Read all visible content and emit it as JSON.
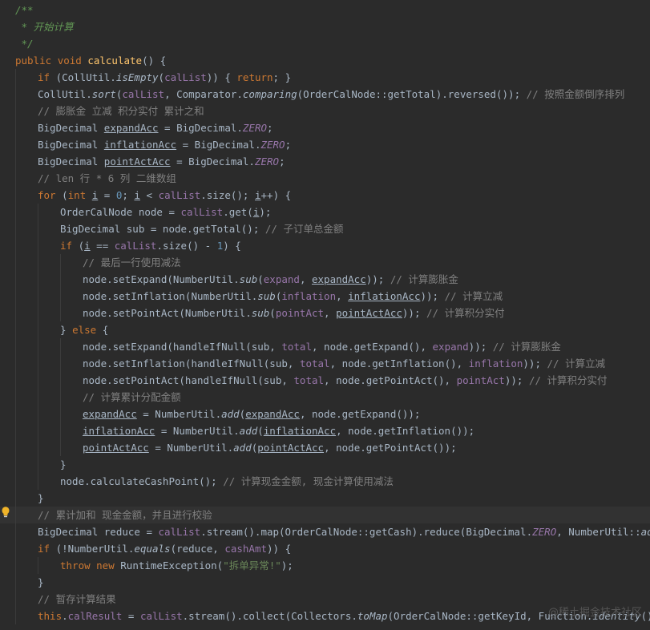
{
  "editor": {
    "lines": [
      {
        "indent": 0,
        "tokens": [
          {
            "t": "/**",
            "c": "dc"
          }
        ]
      },
      {
        "indent": 0,
        "tokens": [
          {
            "t": " * 开始计算",
            "c": "dc"
          }
        ]
      },
      {
        "indent": 0,
        "tokens": [
          {
            "t": " */",
            "c": "dc"
          }
        ]
      },
      {
        "indent": 0,
        "tokens": [
          {
            "t": "public ",
            "c": "kw"
          },
          {
            "t": "void ",
            "c": "kw"
          },
          {
            "t": "calculate",
            "c": "fn"
          },
          {
            "t": "() {"
          }
        ]
      },
      {
        "indent": 1,
        "tokens": [
          {
            "t": "if ",
            "c": "kw"
          },
          {
            "t": "(CollUtil."
          },
          {
            "t": "isEmpty",
            "c": "it"
          },
          {
            "t": "("
          },
          {
            "t": "calList",
            "c": "fld"
          },
          {
            "t": ")) { "
          },
          {
            "t": "return",
            "c": "kw"
          },
          {
            "t": "; }"
          }
        ]
      },
      {
        "indent": 1,
        "tokens": [
          {
            "t": "CollUtil."
          },
          {
            "t": "sort",
            "c": "it"
          },
          {
            "t": "("
          },
          {
            "t": "calList",
            "c": "fld"
          },
          {
            "t": ", Comparator."
          },
          {
            "t": "comparing",
            "c": "it"
          },
          {
            "t": "(OrderCalNode::getTotal).reversed()); "
          },
          {
            "t": "// 按照金额倒序排列",
            "c": "cm"
          }
        ]
      },
      {
        "indent": 1,
        "tokens": [
          {
            "t": "// 膨胀金 立减 积分实付 累计之和",
            "c": "cm"
          }
        ]
      },
      {
        "indent": 1,
        "tokens": [
          {
            "t": "BigDecimal "
          },
          {
            "t": "expandAcc",
            "c": "ul"
          },
          {
            "t": " = BigDecimal."
          },
          {
            "t": "ZERO",
            "c": "fld it"
          },
          {
            "t": ";"
          }
        ]
      },
      {
        "indent": 1,
        "tokens": [
          {
            "t": "BigDecimal "
          },
          {
            "t": "inflationAcc",
            "c": "ul"
          },
          {
            "t": " = BigDecimal."
          },
          {
            "t": "ZERO",
            "c": "fld it"
          },
          {
            "t": ";"
          }
        ]
      },
      {
        "indent": 1,
        "tokens": [
          {
            "t": "BigDecimal "
          },
          {
            "t": "pointActAcc",
            "c": "ul"
          },
          {
            "t": " = BigDecimal."
          },
          {
            "t": "ZERO",
            "c": "fld it"
          },
          {
            "t": ";"
          }
        ]
      },
      {
        "indent": 1,
        "tokens": [
          {
            "t": "// len 行 * 6 列 二维数组",
            "c": "cm"
          }
        ]
      },
      {
        "indent": 1,
        "tokens": [
          {
            "t": "for ",
            "c": "kw"
          },
          {
            "t": "("
          },
          {
            "t": "int ",
            "c": "kw"
          },
          {
            "t": "i",
            "c": "ul"
          },
          {
            "t": " = "
          },
          {
            "t": "0",
            "c": "nu"
          },
          {
            "t": "; "
          },
          {
            "t": "i",
            "c": "ul"
          },
          {
            "t": " < "
          },
          {
            "t": "calList",
            "c": "fld"
          },
          {
            "t": ".size(); "
          },
          {
            "t": "i",
            "c": "ul"
          },
          {
            "t": "++) {"
          }
        ]
      },
      {
        "indent": 2,
        "tokens": [
          {
            "t": "OrderCalNode node = "
          },
          {
            "t": "calList",
            "c": "fld"
          },
          {
            "t": ".get("
          },
          {
            "t": "i",
            "c": "ul"
          },
          {
            "t": ");"
          }
        ]
      },
      {
        "indent": 2,
        "tokens": [
          {
            "t": "BigDecimal sub = node.getTotal(); "
          },
          {
            "t": "// 子订单总金额",
            "c": "cm"
          }
        ]
      },
      {
        "indent": 2,
        "tokens": [
          {
            "t": "if ",
            "c": "kw"
          },
          {
            "t": "("
          },
          {
            "t": "i",
            "c": "ul"
          },
          {
            "t": " == "
          },
          {
            "t": "calList",
            "c": "fld"
          },
          {
            "t": ".size() - "
          },
          {
            "t": "1",
            "c": "nu"
          },
          {
            "t": ") {"
          }
        ]
      },
      {
        "indent": 3,
        "tokens": [
          {
            "t": "// 最后一行使用减法",
            "c": "cm"
          }
        ]
      },
      {
        "indent": 3,
        "tokens": [
          {
            "t": "node.setExpand(NumberUtil."
          },
          {
            "t": "sub",
            "c": "it"
          },
          {
            "t": "("
          },
          {
            "t": "expand",
            "c": "fld"
          },
          {
            "t": ", "
          },
          {
            "t": "expandAcc",
            "c": "ul"
          },
          {
            "t": ")); "
          },
          {
            "t": "// 计算膨胀金",
            "c": "cm"
          }
        ]
      },
      {
        "indent": 3,
        "tokens": [
          {
            "t": "node.setInflation(NumberUtil."
          },
          {
            "t": "sub",
            "c": "it"
          },
          {
            "t": "("
          },
          {
            "t": "inflation",
            "c": "fld"
          },
          {
            "t": ", "
          },
          {
            "t": "inflationAcc",
            "c": "ul"
          },
          {
            "t": ")); "
          },
          {
            "t": "// 计算立减",
            "c": "cm"
          }
        ]
      },
      {
        "indent": 3,
        "tokens": [
          {
            "t": "node.setPointAct(NumberUtil."
          },
          {
            "t": "sub",
            "c": "it"
          },
          {
            "t": "("
          },
          {
            "t": "pointAct",
            "c": "fld"
          },
          {
            "t": ", "
          },
          {
            "t": "pointActAcc",
            "c": "ul"
          },
          {
            "t": ")); "
          },
          {
            "t": "// 计算积分实付",
            "c": "cm"
          }
        ]
      },
      {
        "indent": 2,
        "tokens": [
          {
            "t": "} "
          },
          {
            "t": "else ",
            "c": "kw"
          },
          {
            "t": "{"
          }
        ]
      },
      {
        "indent": 3,
        "tokens": [
          {
            "t": "node.setExpand(handleIfNull(sub, "
          },
          {
            "t": "total",
            "c": "fld"
          },
          {
            "t": ", node.getExpand(), "
          },
          {
            "t": "expand",
            "c": "fld"
          },
          {
            "t": ")); "
          },
          {
            "t": "// 计算膨胀金",
            "c": "cm"
          }
        ]
      },
      {
        "indent": 3,
        "tokens": [
          {
            "t": "node.setInflation(handleIfNull(sub, "
          },
          {
            "t": "total",
            "c": "fld"
          },
          {
            "t": ", node.getInflation(), "
          },
          {
            "t": "inflation",
            "c": "fld"
          },
          {
            "t": ")); "
          },
          {
            "t": "// 计算立减",
            "c": "cm"
          }
        ]
      },
      {
        "indent": 3,
        "tokens": [
          {
            "t": "node.setPointAct(handleIfNull(sub, "
          },
          {
            "t": "total",
            "c": "fld"
          },
          {
            "t": ", node.getPointAct(), "
          },
          {
            "t": "pointAct",
            "c": "fld"
          },
          {
            "t": ")); "
          },
          {
            "t": "// 计算积分实付",
            "c": "cm"
          }
        ]
      },
      {
        "indent": 3,
        "tokens": [
          {
            "t": "// 计算累计分配金额",
            "c": "cm"
          }
        ]
      },
      {
        "indent": 3,
        "tokens": [
          {
            "t": "expandAcc",
            "c": "ul"
          },
          {
            "t": " = NumberUtil."
          },
          {
            "t": "add",
            "c": "it"
          },
          {
            "t": "("
          },
          {
            "t": "expandAcc",
            "c": "ul"
          },
          {
            "t": ", node.getExpand());"
          }
        ]
      },
      {
        "indent": 3,
        "tokens": [
          {
            "t": "inflationAcc",
            "c": "ul"
          },
          {
            "t": " = NumberUtil."
          },
          {
            "t": "add",
            "c": "it"
          },
          {
            "t": "("
          },
          {
            "t": "inflationAcc",
            "c": "ul"
          },
          {
            "t": ", node.getInflation());"
          }
        ]
      },
      {
        "indent": 3,
        "tokens": [
          {
            "t": "pointActAcc",
            "c": "ul"
          },
          {
            "t": " = NumberUtil."
          },
          {
            "t": "add",
            "c": "it"
          },
          {
            "t": "("
          },
          {
            "t": "pointActAcc",
            "c": "ul"
          },
          {
            "t": ", node.getPointAct());"
          }
        ]
      },
      {
        "indent": 2,
        "tokens": [
          {
            "t": "}"
          }
        ]
      },
      {
        "indent": 2,
        "tokens": [
          {
            "t": "node.calculateCashPoint(); "
          },
          {
            "t": "// 计算现金金额, 现金计算使用减法",
            "c": "cm"
          }
        ]
      },
      {
        "indent": 1,
        "tokens": [
          {
            "t": "}"
          }
        ]
      },
      {
        "indent": 1,
        "hl": true,
        "tokens": [
          {
            "t": "// 累计加和 现金金额，并且进行校验",
            "c": "cm"
          }
        ]
      },
      {
        "indent": 1,
        "tokens": [
          {
            "t": "BigDecimal reduce = "
          },
          {
            "t": "calList",
            "c": "fld"
          },
          {
            "t": ".stream().map(OrderCalNode::getCash).reduce(BigDecimal."
          },
          {
            "t": "ZERO",
            "c": "fld it"
          },
          {
            "t": ", NumberUtil::"
          },
          {
            "t": "add",
            "c": "it"
          },
          {
            "t": ");"
          }
        ]
      },
      {
        "indent": 1,
        "tokens": [
          {
            "t": "if ",
            "c": "kw"
          },
          {
            "t": "(!NumberUtil."
          },
          {
            "t": "equals",
            "c": "it"
          },
          {
            "t": "(reduce, "
          },
          {
            "t": "cashAmt",
            "c": "fld"
          },
          {
            "t": ")) {"
          }
        ]
      },
      {
        "indent": 2,
        "tokens": [
          {
            "t": "throw ",
            "c": "kw"
          },
          {
            "t": "new ",
            "c": "kw"
          },
          {
            "t": "RuntimeException("
          },
          {
            "t": "\"拆单异常!\"",
            "c": "st"
          },
          {
            "t": ");"
          }
        ]
      },
      {
        "indent": 1,
        "tokens": [
          {
            "t": "}"
          }
        ]
      },
      {
        "indent": 1,
        "tokens": [
          {
            "t": "// 暂存计算结果",
            "c": "cm"
          }
        ]
      },
      {
        "indent": 1,
        "tokens": [
          {
            "t": "this",
            "c": "kw"
          },
          {
            "t": "."
          },
          {
            "t": "calResult",
            "c": "fld"
          },
          {
            "t": " = "
          },
          {
            "t": "calList",
            "c": "fld"
          },
          {
            "t": ".stream().collect(Collectors."
          },
          {
            "t": "toMap",
            "c": "it"
          },
          {
            "t": "(OrderCalNode::getKeyId, Function."
          },
          {
            "t": "identity",
            "c": "it"
          },
          {
            "t": "()));"
          }
        ]
      }
    ]
  },
  "watermark": "@稀土掘金技术社区",
  "icons": {
    "gutter": "lightbulb-icon"
  }
}
